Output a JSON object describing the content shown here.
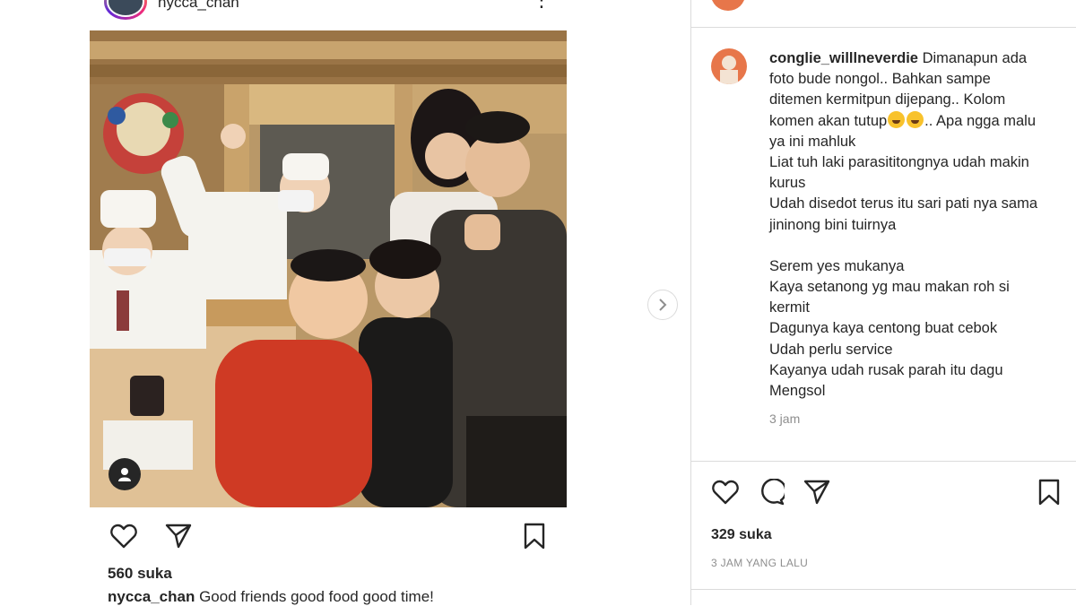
{
  "post": {
    "username": "nycca_chan",
    "likes": "560 suka",
    "caption_user": "nycca_chan",
    "caption_text": "Good friends good food good time!"
  },
  "comments_panel": {
    "comment": {
      "username": "conglie_willlneverdie",
      "text_line1": "Dimanapun ada foto bude nongol.. Bahkan sampe ditemen kermitpun dijepang.. Kolom komen akan tutup",
      "text_line1b": ".. Apa ngga malu ya ini mahluk",
      "line2": "Liat tuh laki parasititongnya udah makin kurus",
      "line3": "Udah disedot terus itu sari pati nya sama jininong bini tuirnya",
      "line4": "Serem yes mukanya",
      "line5": "Kaya setanong yg mau makan roh si kermit",
      "line6": "Dagunya kaya centong buat cebok",
      "line7": "Udah perlu service",
      "line8": "Kayanya udah rusak parah itu dagu",
      "line9": "Mengsol",
      "time": "3 jam"
    },
    "likes": "329 suka",
    "posted_ago": "3 JAM YANG LALU"
  },
  "icons": {
    "like": "heart-icon",
    "comment": "comment-icon",
    "share": "send-icon",
    "save": "bookmark-icon",
    "next": "chevron-right-icon",
    "tag": "user-tag-icon",
    "more": "more-dots-icon"
  }
}
